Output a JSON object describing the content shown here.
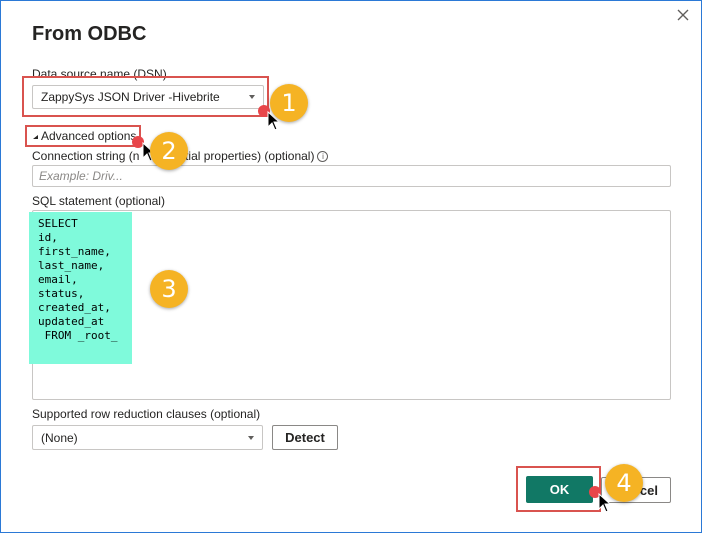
{
  "dialog": {
    "title": "From ODBC",
    "close_icon": "close-icon"
  },
  "dsn": {
    "label": "Data source name (DSN)",
    "value": "ZappySys JSON Driver -Hivebrite"
  },
  "advanced": {
    "label": "Advanced options"
  },
  "connection_string": {
    "label": "Connection string (non-credential properties) (optional)",
    "label_visible_start": "Connection string (n",
    "label_visible_end": "ntial properties) (optional)",
    "placeholder": "Example: Driv..."
  },
  "sql": {
    "label": "SQL statement (optional)",
    "value": "SELECT\nid,\nfirst_name,\nlast_name,\nemail,\nstatus,\ncreated_at,\nupdated_at\n FROM _root_"
  },
  "row_reduction": {
    "label": "Supported row reduction clauses (optional)",
    "value": "(None)",
    "detect_label": "Detect"
  },
  "footer": {
    "ok_label": "OK",
    "cancel_label_visible": "cel"
  },
  "callouts": [
    "1",
    "2",
    "3",
    "4"
  ],
  "colors": {
    "primary": "#117865",
    "badge": "#f5b324",
    "highlight": "#7ffadb",
    "annotation_border": "#d9534f",
    "window_border": "#2b79d6"
  }
}
